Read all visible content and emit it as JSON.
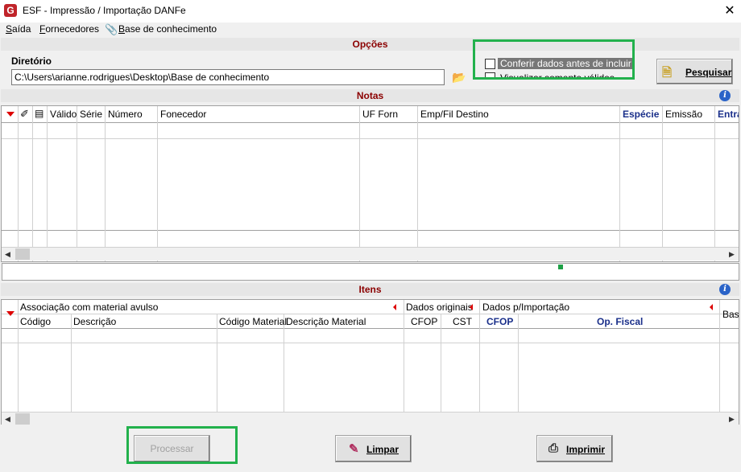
{
  "window": {
    "title": "ESF - Impressão / Importação DANFe",
    "logo_letter": "G",
    "close_glyph": "✕"
  },
  "menu": [
    {
      "label": "Saída",
      "underline": "S",
      "rest": "aída"
    },
    {
      "label": "Fornecedores",
      "underline": "F",
      "rest": "ornecedores"
    },
    {
      "label": "Base de conhecimento",
      "underline": "B",
      "rest": "ase de conhecimento"
    }
  ],
  "opcoes": {
    "title": "Opções",
    "dir_label": "Diretório",
    "dir_value": "C:\\Users\\arianne.rodrigues\\Desktop\\Base de conhecimento",
    "cb_conferir": "Conferir dados antes de incluir",
    "cb_visualizar": "Visualizar somente válidos",
    "pesquisar": "Pesquisar"
  },
  "notas": {
    "title": "Notas",
    "columns": [
      "Válido",
      "Série",
      "Número",
      "Fonecedor",
      "UF Forn",
      "Emp/Fil Destino",
      "Espécie",
      "Emissão",
      "Entra"
    ]
  },
  "itens": {
    "title": "Itens",
    "groups": [
      "Associação com material avulso",
      "Dados originais",
      "Dados p/Importação",
      "Base"
    ],
    "columns": [
      "Código",
      "Descrição",
      "Código Material",
      "Descrição Material",
      "CFOP",
      "CST",
      "CFOP",
      "Op. Fiscal"
    ]
  },
  "buttons": {
    "processar": "Processar",
    "limpar": "Limpar",
    "imprimir": "Imprimir"
  },
  "colors": {
    "highlight": "#22b14c",
    "section_title": "#8b0000",
    "header_blue": "#1a2f8a"
  }
}
